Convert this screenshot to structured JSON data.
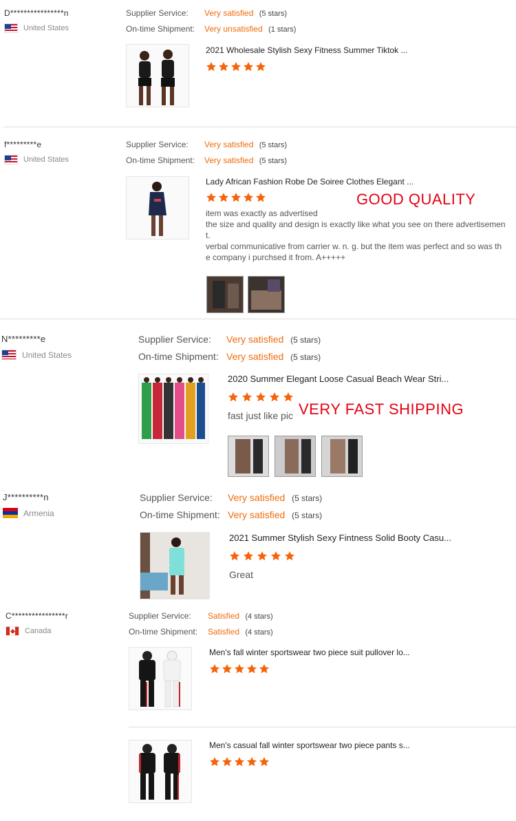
{
  "reviews": [
    {
      "buyer": "D****************n",
      "country": "United States",
      "supplier_label": "Supplier Service:",
      "supplier_value": "Very satisfied",
      "supplier_count": "(5 stars)",
      "shipment_label": "On-time Shipment:",
      "shipment_value": "Very unsatisfied",
      "shipment_count": "(1 stars)",
      "product_title": "2021 Wholesale Stylish Sexy Fitness Summer Tiktok ...",
      "rating": 5
    },
    {
      "buyer": "f*********e",
      "country": "United States",
      "supplier_label": "Supplier Service:",
      "supplier_value": "Very satisfied",
      "supplier_count": "(5 stars)",
      "shipment_label": "On-time Shipment:",
      "shipment_value": "Very satisfied",
      "shipment_count": "(5 stars)",
      "product_title": "Lady African Fashion Robe De Soiree Clothes Elegant ...",
      "rating": 5,
      "banner": "GOOD QUALITY",
      "comment_lines": [
        "item was exactly as advertised",
        "the size and quality and design is exactly like what you see on there advertisemen",
        "t.",
        "verbal communicative from carrier w. n. g. but the item was perfect and so was th",
        "e company i purchsed it from. A+++++"
      ]
    },
    {
      "buyer": "N*********e",
      "country": "United States",
      "supplier_label": "Supplier Service:",
      "supplier_value": "Very satisfied",
      "supplier_count": "(5 stars)",
      "shipment_label": "On-time Shipment:",
      "shipment_value": "Very satisfied",
      "shipment_count": "(5 stars)",
      "product_title": "2020 Summer Elegant Loose Casual Beach Wear Stri...",
      "rating": 5,
      "comment": "fast just like pic",
      "banner": "VERY FAST SHIPPING"
    },
    {
      "buyer": "J**********n",
      "country": "Armenia",
      "supplier_label": "Supplier Service:",
      "supplier_value": "Very satisfied",
      "supplier_count": "(5 stars)",
      "shipment_label": "On-time Shipment:",
      "shipment_value": "Very satisfied",
      "shipment_count": "(5 stars)",
      "product_title": "2021 Summer Stylish Sexy Fintness Solid Booty Casu...",
      "rating": 5,
      "comment": "Great"
    },
    {
      "buyer": "C****************r",
      "country": "Canada",
      "supplier_label": "Supplier Service:",
      "supplier_value": "Satisfied",
      "supplier_count": "(4 stars)",
      "shipment_label": "On-time Shipment:",
      "shipment_value": "Satisfied",
      "shipment_count": "(4 stars)",
      "product_title": "Men's fall winter sportswear two piece suit pullover lo...",
      "rating": 5,
      "product_title_2": "Men's casual fall winter sportswear two piece pants s...",
      "rating_2": 5
    }
  ],
  "colors": {
    "accent": "#f06b0b",
    "banner": "#e60012",
    "star": "#f5640a"
  }
}
